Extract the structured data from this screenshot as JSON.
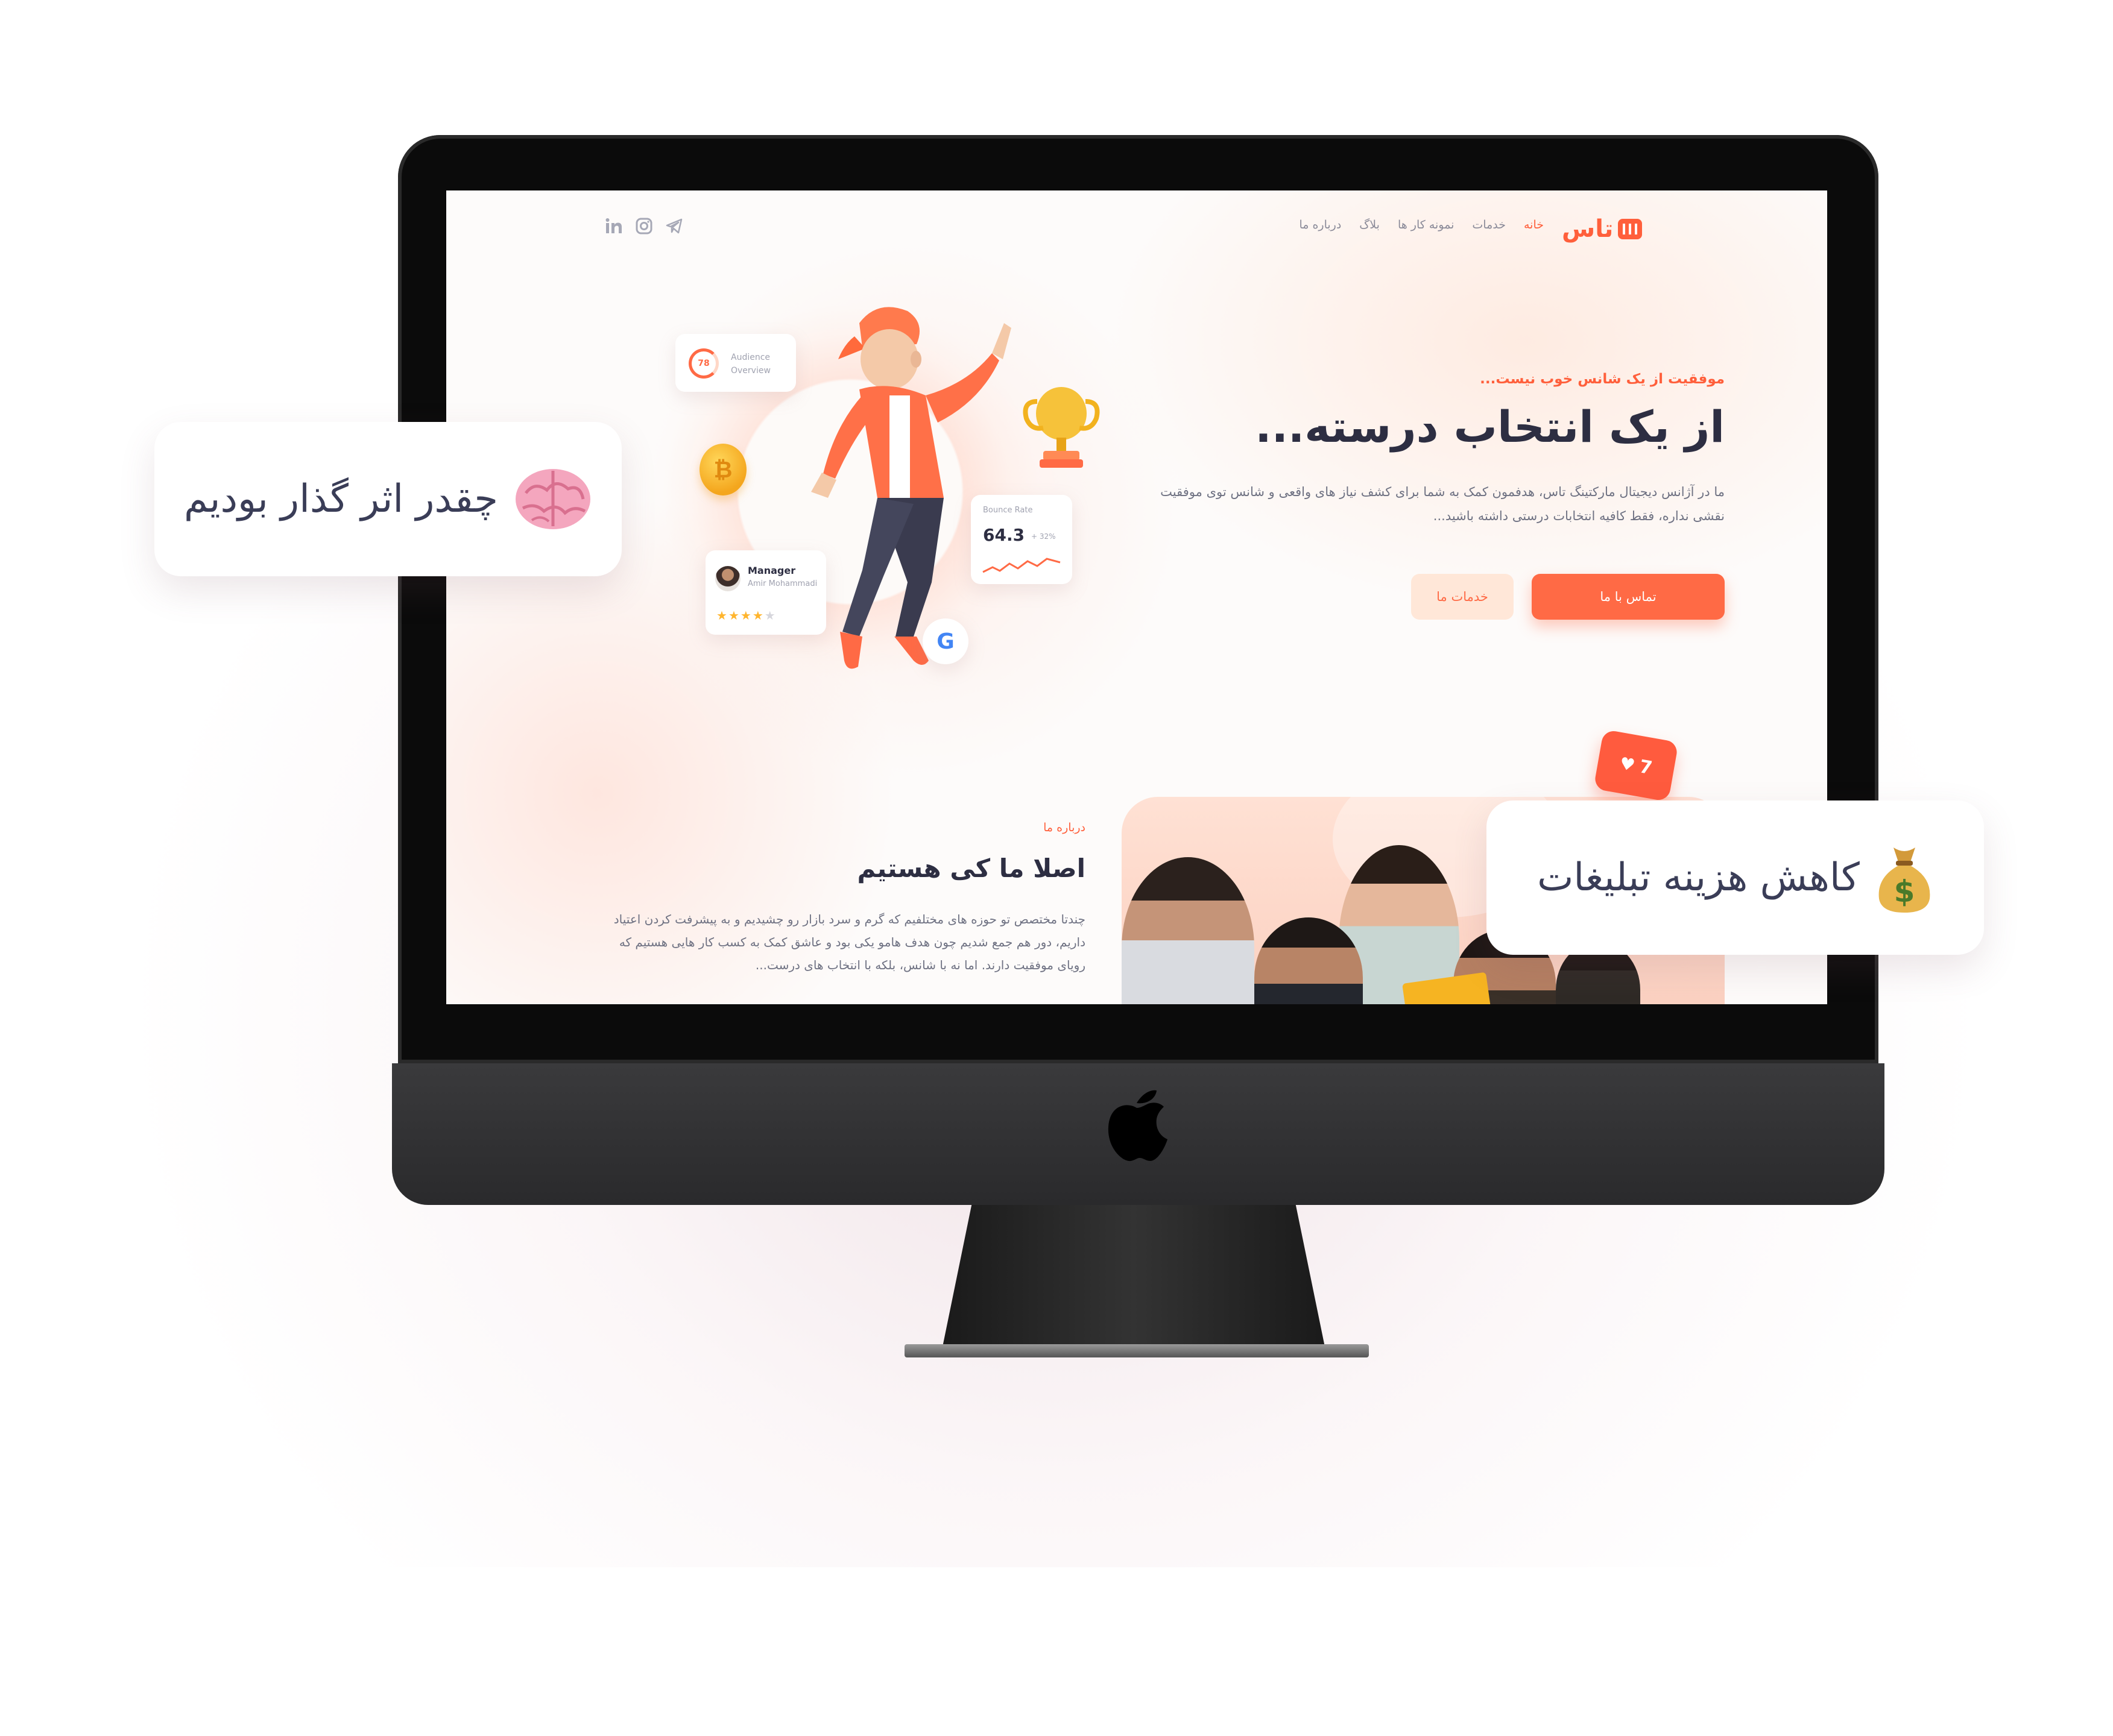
{
  "site": {
    "logo_text": "تاس",
    "nav": [
      "خانه",
      "خدمات",
      "نمونه کار ها",
      "بلاگ",
      "درباره ما"
    ],
    "social_icons": [
      "linkedin-icon",
      "instagram-icon",
      "telegram-icon"
    ]
  },
  "hero": {
    "kicker": "موفقیت از یک شانس خوب نیست...",
    "title": "از یک انتخاب درسته...",
    "description": "ما در آژانس دیجیتال مارکتینگ تاس، هدفمون کمک به شما برای کشف نیاز های واقعی و شانس توی موفقیت نقشی نداره، فقط کافیه انتخابات درستی داشته باشید...",
    "primary_button": "تماس با ما",
    "secondary_button": "خدمات ما"
  },
  "widgets": {
    "audience_value": "78",
    "audience_label_1": "Audience",
    "audience_label_2": "Overview",
    "bounce_title": "Bounce Rate",
    "bounce_value": "64.3",
    "bounce_delta": "+ 32%",
    "manager_title": "Manager",
    "manager_name": "Amir Mohammadi",
    "rating": 4,
    "rating_max": 5,
    "google_letter": "G",
    "coin_symbol": "₿"
  },
  "about": {
    "kicker": "درباره ما",
    "title": "اصلا ما کی هستیم",
    "text": "چندتا مختصص تو حوزه های مختلفیم که گرم و سرد بازار رو چشیدیم و به پیشرفت کردن اعتیاد داریم، دور هم جمع شدیم چون هدف هامو یکی بود و عاشق کمک به کسب کار هایی هستیم که رویای موفقیت دارند. اما نه با شانس، بلکه با انتخاب های درست..."
  },
  "notification": {
    "count": "7"
  },
  "callouts": {
    "impact": "چقدر اثر گذار بودیم",
    "ads_cost": "کاهش هزینه تبلیغات"
  },
  "colors": {
    "accent": "#ff5f3b",
    "text_dark": "#2d2e42",
    "text_muted": "#6e7182"
  }
}
